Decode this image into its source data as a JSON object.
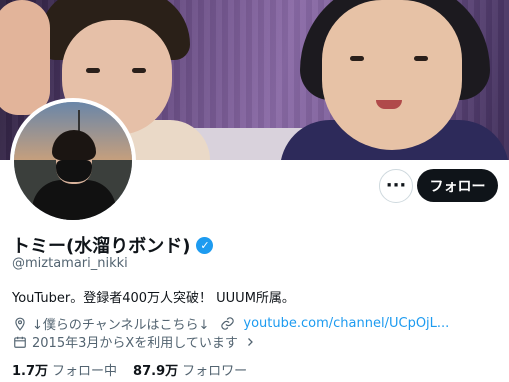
{
  "profile": {
    "display_name": "トミー(水溜りボンド)",
    "handle": "@miztamari_nikki",
    "bio": "YouTuber。登録者400万人突破！ UUUM所属。",
    "location": "↓僕らのチャンネルはこちら↓",
    "website": "youtube.com/channel/UCpOjL...",
    "joined": "2015年3月からXを利用しています",
    "verified": true
  },
  "actions": {
    "more_label": "···",
    "follow_label": "フォロー"
  },
  "stats": {
    "following_count": "1.7万",
    "following_label": "フォロー中",
    "followers_count": "87.9万",
    "followers_label": "フォロワー"
  },
  "icons": {
    "location": "location-pin-icon",
    "link": "link-icon",
    "calendar": "calendar-icon",
    "verified": "verified-badge-icon",
    "chevron": "chevron-right-icon"
  },
  "colors": {
    "accent": "#1d9bf0",
    "text": "#0f1419",
    "muted": "#536471",
    "follow_button": "#0f1419"
  }
}
